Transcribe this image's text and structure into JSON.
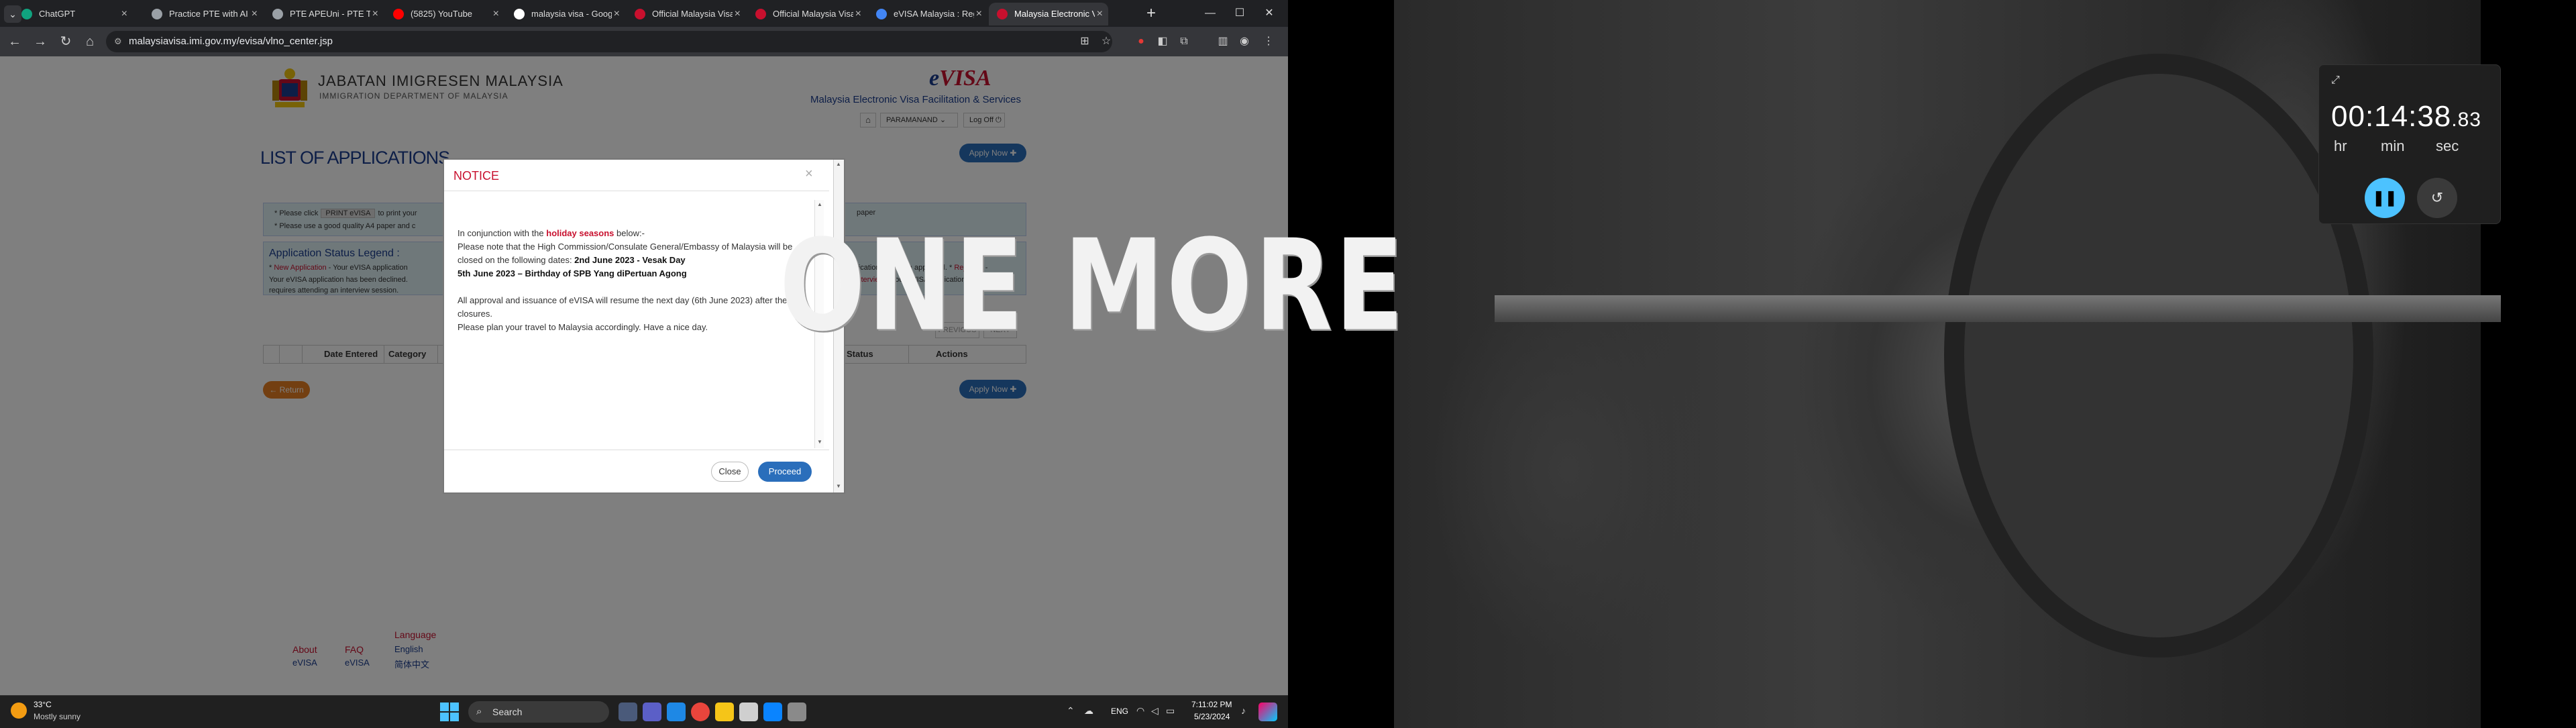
{
  "browser": {
    "tabs": [
      {
        "title": "ChatGPT",
        "favicon_color": "#10a37f"
      },
      {
        "title": "Practice PTE with AI Sc",
        "favicon_color": "#9aa0a6"
      },
      {
        "title": "PTE APEUni - PTE Test",
        "favicon_color": "#9aa0a6"
      },
      {
        "title": "(5825) YouTube",
        "favicon_color": "#ff0000"
      },
      {
        "title": "malaysia visa - Google",
        "favicon_color": "#ffffff"
      },
      {
        "title": "Official Malaysia Visa",
        "favicon_color": "#c8102e"
      },
      {
        "title": "Official Malaysia Visa",
        "favicon_color": "#c8102e"
      },
      {
        "title": "eVISA Malaysia : Reg",
        "favicon_color": "#4285f4"
      },
      {
        "title": "Malaysia Electronic Vi",
        "favicon_color": "#c8102e"
      }
    ],
    "url": "malaysiavisa.imi.gov.my/evisa/vlno_center.jsp"
  },
  "site": {
    "dept_title": "JABATAN IMIGRESEN MALAYSIA",
    "dept_subtitle": "IMMIGRATION DEPARTMENT OF MALAYSIA",
    "logo_e": "e",
    "logo_visa": "VISA",
    "tagline": "Malaysia Electronic Visa Facilitation & Services",
    "user_name": "PARAMANAND",
    "log_off": "Log Off",
    "page_title": "LIST OF APPLICATIONS",
    "apply_now": "Apply Now",
    "info_please_click": "Please click",
    "info_print_btn": "PRINT eVISA",
    "info_to_print": "to print your",
    "info_paper": "paper",
    "info_line2": "Please use a good quality A4 paper and c",
    "legend_title": "Application Status Legend :",
    "legend_new": "New Application",
    "legend_l1": " - Your eVISA application",
    "legend_l1b": "application has been approved.",
    "legend_rejected": "Rejected",
    "legend_l2": "Your eVISA application has been declined.",
    "legend_interview": "ed Interview",
    "legend_l2b": " - Your eVISA application",
    "legend_l3": "requires attending an interview session.",
    "previous": "PREVIOUS",
    "next": "NEXT",
    "col_date": "Date Entered",
    "col_category": "Category",
    "col_status": "Status",
    "col_actions": "Actions",
    "return_btn": "Return",
    "footer_about": "About",
    "footer_faq": "FAQ",
    "footer_language": "Language",
    "footer_evisa1": "eVISA",
    "footer_evisa2": "eVISA",
    "footer_english": "English",
    "footer_chinese": "简体中文"
  },
  "modal": {
    "title": "NOTICE",
    "p1_pre": "In conjunction with the ",
    "p1_hl": "holiday seasons",
    "p1_post": " below:-",
    "p2": "Please note that the High Commission/Consulate General/Embassy of Malaysia will be closed on the following dates: ",
    "date1": "2nd June 2023 - Vesak Day",
    "date2": "5th June 2023 – Birthday of SPB Yang diPertuan Agong",
    "p3": "All approval and issuance of eVISA will resume the next day (6th June 2023) after these closures.",
    "p4": "Please plan your travel to Malaysia accordingly. Have a nice day.",
    "close": "Close",
    "proceed": "Proceed"
  },
  "wallpaper": {
    "slogan": "ONE MORE"
  },
  "clock": {
    "time_main": "00:14:38",
    "time_frac": ".83",
    "label_hr": "hr",
    "label_min": "min",
    "label_sec": "sec"
  },
  "taskbar": {
    "temperature": "33°C",
    "weather": "Mostly sunny",
    "search": "Search",
    "lang": "ENG",
    "time": "7:11:02 PM",
    "date": "5/23/2024"
  },
  "icons": {
    "back": "arrow-left",
    "forward": "arrow-right",
    "reload": "reload",
    "home": "home",
    "lock": "lock",
    "star": "star",
    "pin": "pin",
    "pause": "pause",
    "reset": "reset"
  }
}
